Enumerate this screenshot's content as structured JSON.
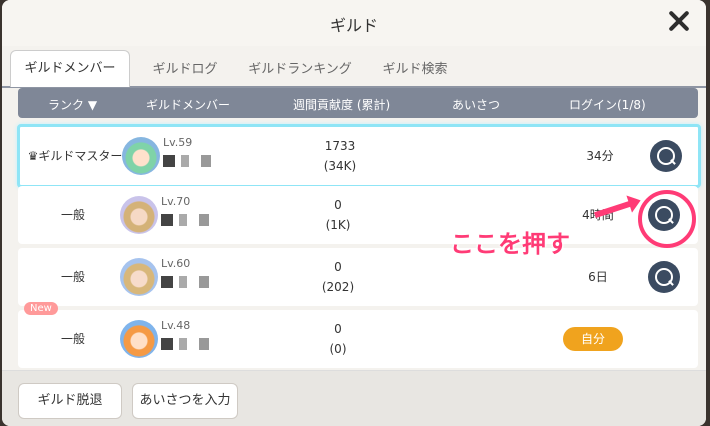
{
  "title": "ギルド",
  "tabs": [
    {
      "label": "ギルドメンバー"
    },
    {
      "label": "ギルドログ"
    },
    {
      "label": "ギルドランキング"
    },
    {
      "label": "ギルド検索"
    }
  ],
  "header": {
    "rank": "ランク ▼",
    "member": "ギルドメンバー",
    "contrib": "週間貢献度 (累計)",
    "greet": "あいさつ",
    "login": "ログイン(1/8)"
  },
  "rows": [
    {
      "rank": "♛ギルドマスター",
      "level": "Lv.59",
      "contrib": "1733",
      "contrib_total": "(34K)",
      "login": "34分",
      "detail": "details",
      "badge": ""
    },
    {
      "rank": "一般",
      "level": "Lv.70",
      "contrib": "0",
      "contrib_total": "(1K)",
      "login": "4時間",
      "detail": "details",
      "badge": ""
    },
    {
      "rank": "一般",
      "level": "Lv.60",
      "contrib": "0",
      "contrib_total": "(202)",
      "login": "6日",
      "detail": "details",
      "badge": ""
    },
    {
      "rank": "一般",
      "level": "Lv.48",
      "contrib": "0",
      "contrib_total": "(0)",
      "login": "自分",
      "detail": "",
      "badge": "New"
    }
  ],
  "footer": {
    "leave": "ギルド脱退",
    "greet": "あいさつを入力"
  },
  "annotation": "ここを押す"
}
